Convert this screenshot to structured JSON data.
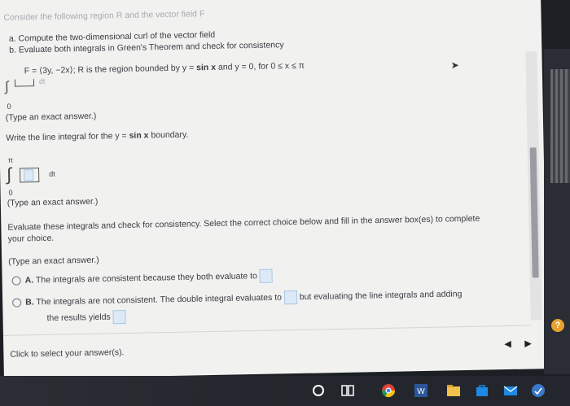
{
  "problem": {
    "intro": "Consider the following region R and the vector field F",
    "part_a": "a. Compute the two-dimensional curl of the vector field",
    "part_b": "b. Evaluate both integrals in Green's Theorem and check for consistency",
    "field_prefix": "F = ⟨3y, −2x⟩; R is the region bounded by y =",
    "field_sinx": "sin x",
    "field_suffix": "and y = 0, for 0 ≤ x ≤ π"
  },
  "integral1": {
    "lower": "0",
    "dt": "dt"
  },
  "hint1": "(Type an exact answer.)",
  "prompt_line": {
    "prefix": "Write the line integral for the y =",
    "sinx": "sin x",
    "suffix": "boundary."
  },
  "integral2": {
    "upper": "π",
    "lower": "0",
    "dt": "dt"
  },
  "hint2": "(Type an exact answer.)",
  "evaluate": {
    "line1": "Evaluate these integrals and check for consistency. Select the correct choice below and fill in the answer box(es) to complete",
    "line2": "your choice."
  },
  "hint3": "(Type an exact answer.)",
  "choices": [
    {
      "letter": "A.",
      "text": "The integrals are consistent because they both evaluate to"
    },
    {
      "letter": "B.",
      "text1": "The integrals are not consistent. The double integral evaluates to",
      "text2": "but evaluating the line integrals and adding",
      "text3": "the results yields"
    }
  ],
  "footer": "Click to select your answer(s).",
  "nav": {
    "prev": "◀",
    "next": "▶"
  },
  "help": "?",
  "colors": {
    "page": "#f1f1ef",
    "text": "#3a3d44",
    "answer_box": "#dde9f6",
    "taskbar": "#23262c",
    "help": "#e7a22f"
  }
}
